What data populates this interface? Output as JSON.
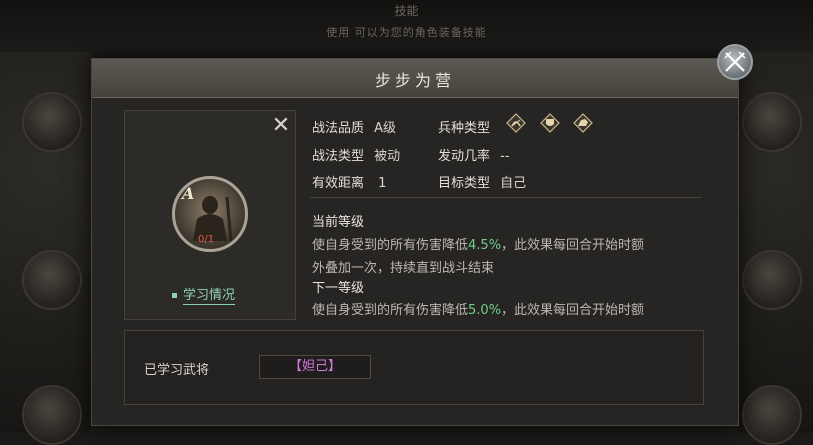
{
  "background": {
    "top_line1": "技能",
    "top_line2": "使用 可以为您的角色装备技能",
    "side_labels": [
      "",
      "",
      "",
      ""
    ]
  },
  "dialog": {
    "title": "步步为营"
  },
  "skill": {
    "grade_badge": "A",
    "progress": "0/1",
    "learn_link": "学习情况"
  },
  "attributes": {
    "quality_label": "战法品质",
    "quality_value": "A级",
    "type_label": "战法类型",
    "type_value": "被动",
    "range_label": "有效距离",
    "range_value": "1",
    "troop_label": "兵种类型",
    "troop_icons": [
      "archer-icon",
      "shield-icon",
      "cavalry-icon"
    ],
    "chance_label": "发动几率",
    "chance_value": "--",
    "target_label": "目标类型",
    "target_value": "自己"
  },
  "current_level": {
    "heading": "当前等级",
    "line1_prefix": "使自身受到的所有伤害降低",
    "line1_value": "4.5%",
    "line1_suffix": "，此效果每回合开始时额",
    "line2": "外叠加一次，持续直到战斗结束"
  },
  "next_level": {
    "heading": "下一等级",
    "line1_prefix": "使自身受到的所有伤害降低",
    "line1_value": "5.0%",
    "line1_suffix": "，此效果每回合开始时额"
  },
  "learned": {
    "label": "已学习武将",
    "general": "【妲己】"
  },
  "colors": {
    "highlight": "#6fcf8a",
    "general_name": "#d07ad8",
    "link": "#8fd0b8"
  }
}
